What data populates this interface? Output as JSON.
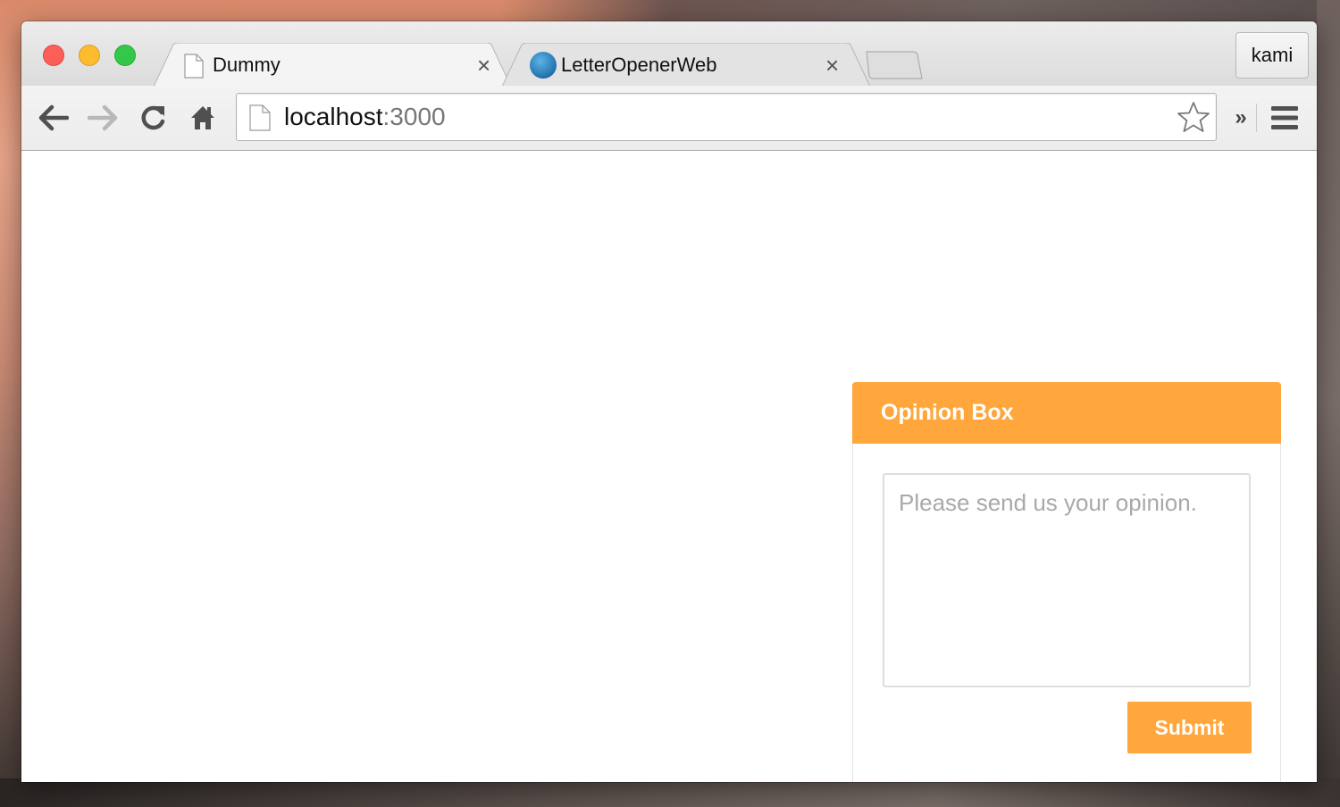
{
  "browser": {
    "profile_name": "kami",
    "tabs": [
      {
        "title": "Dummy",
        "icon": "page-icon",
        "active": true
      },
      {
        "title": "LetterOpenerWeb",
        "icon": "globe-icon",
        "active": false
      }
    ],
    "address": {
      "host": "localhost",
      "port": ":3000"
    }
  },
  "opinion_box": {
    "title": "Opinion Box",
    "placeholder": "Please send us your opinion.",
    "submit_label": "Submit",
    "accent_color": "#ffa73d"
  }
}
